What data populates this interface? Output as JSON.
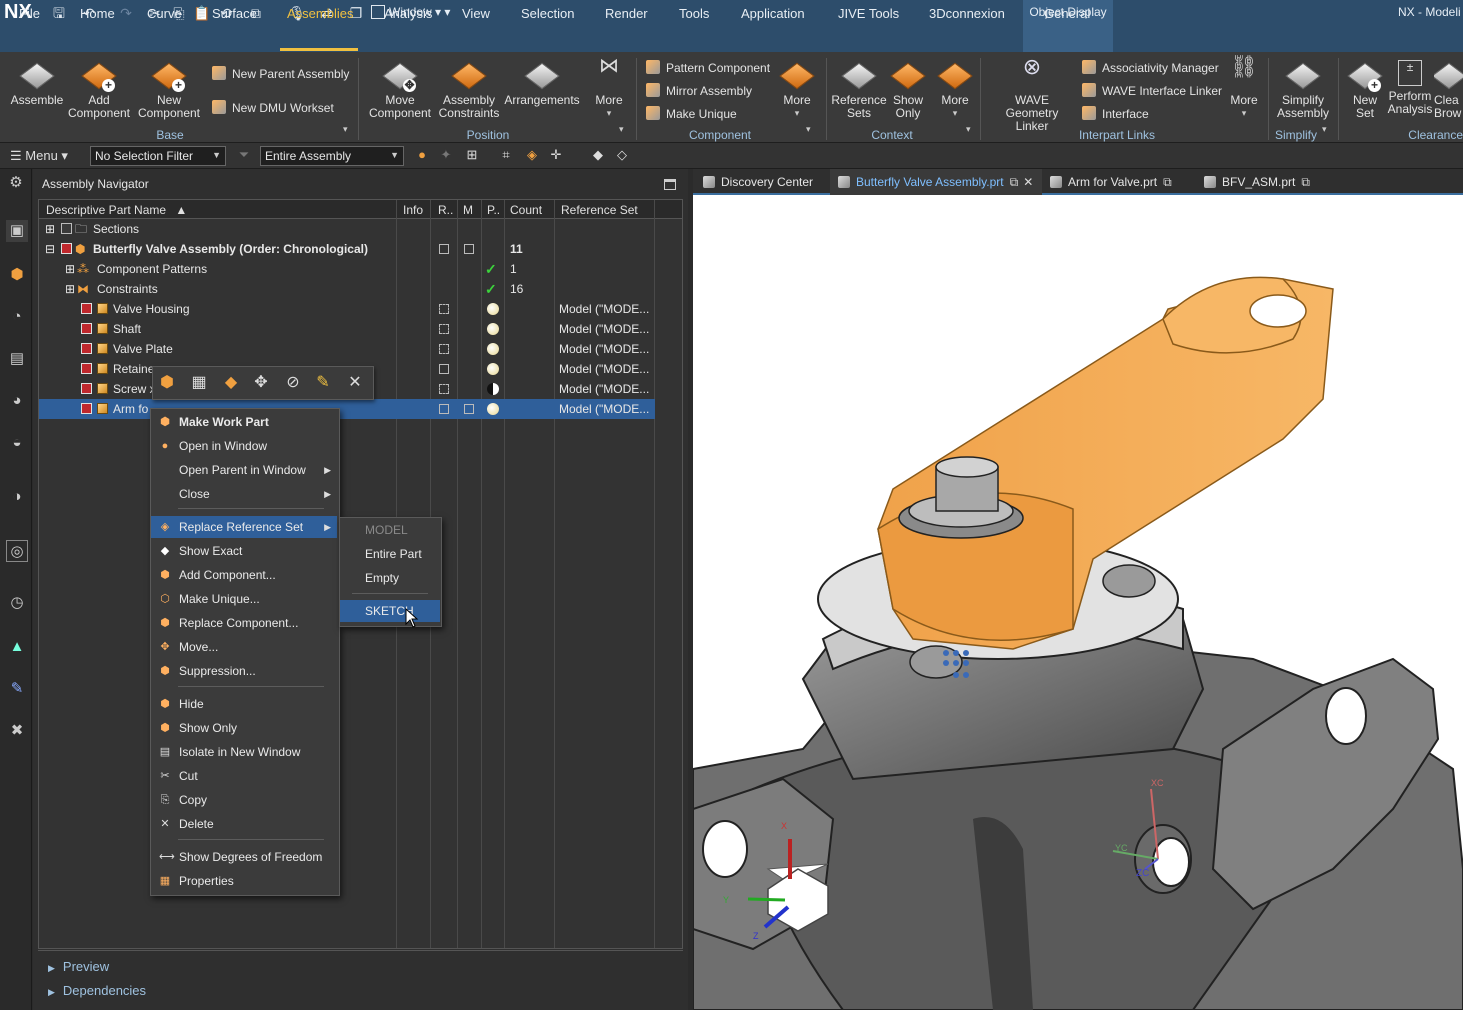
{
  "app": {
    "logo": "NX",
    "title": "NX - Modeli",
    "window_menu": "Window",
    "contextual_tab": "Object Display"
  },
  "tabs": [
    "File",
    "Home",
    "Curve",
    "Surface",
    "Assemblies",
    "Analysis",
    "View",
    "Selection",
    "Render",
    "Tools",
    "Application",
    "JIVE Tools",
    "3Dconnexion",
    "General"
  ],
  "active_tab": "Assemblies",
  "ribbon": {
    "assemble": "Assemble",
    "add_component": "Add Component",
    "new_component": "New Component",
    "new_parent_assembly": "New Parent Assembly",
    "new_dmu_workset": "New DMU Workset",
    "group_base": "Base",
    "move_component": "Move Component",
    "assembly_constraints": "Assembly Constraints",
    "arrangements": "Arrangements",
    "more_position": "More",
    "group_position": "Position",
    "pattern_component": "Pattern Component",
    "mirror_assembly": "Mirror Assembly",
    "make_unique": "Make Unique",
    "more_component": "More",
    "group_component": "Component",
    "reference_sets": "Reference Sets",
    "show_only": "Show Only",
    "more_context": "More",
    "group_context": "Context",
    "wave_geometry_linker": "WAVE Geometry Linker",
    "associativity_manager": "Associativity Manager",
    "wave_interface_linker": "WAVE Interface Linker",
    "interface": "Interface",
    "more_interpart": "More",
    "group_interpart": "Interpart Links",
    "simplify_assembly": "Simplify Assembly",
    "group_simplify": "Simplify",
    "new_set": "New Set",
    "perform_analysis": "Perform Analysis",
    "clean_brow": "Clea Brow",
    "group_clearance": "Clearance"
  },
  "toolbar": {
    "menu": "Menu",
    "selection_filter": "No Selection Filter",
    "scope": "Entire Assembly"
  },
  "navigator": {
    "title": "Assembly Navigator",
    "columns": [
      "Descriptive Part Name",
      "Info",
      "R..",
      "M",
      "P..",
      "Count",
      "Reference Set"
    ],
    "rows": [
      {
        "name": "Sections",
        "count": "",
        "refset": ""
      },
      {
        "name": "Butterfly Valve Assembly (Order: Chronological)",
        "count": "11",
        "refset": ""
      },
      {
        "name": "Component Patterns",
        "count": "1",
        "refset": ""
      },
      {
        "name": "Constraints",
        "count": "16",
        "refset": ""
      },
      {
        "name": "Valve Housing",
        "count": "",
        "refset": "Model (\"MODE..."
      },
      {
        "name": "Shaft",
        "count": "",
        "refset": "Model (\"MODE..."
      },
      {
        "name": "Valve Plate",
        "count": "",
        "refset": "Model (\"MODE..."
      },
      {
        "name": "Retaine",
        "count": "",
        "refset": "Model (\"MODE..."
      },
      {
        "name": "Screw x",
        "count": "",
        "refset": "Model (\"MODE..."
      },
      {
        "name": "Arm fo",
        "count": "",
        "refset": "Model (\"MODE..."
      }
    ],
    "preview": "Preview",
    "dependencies": "Dependencies"
  },
  "context_menu": [
    "Make Work Part",
    "Open in Window",
    "Open Parent in Window",
    "Close",
    "Replace Reference Set",
    "Show Exact",
    "Add Component...",
    "Make Unique...",
    "Replace Component...",
    "Move...",
    "Suppression...",
    "Hide",
    "Show Only",
    "Isolate in New Window",
    "Cut",
    "Copy",
    "Delete",
    "Show Degrees of Freedom",
    "Properties"
  ],
  "submenu": [
    "MODEL",
    "Entire Part",
    "Empty",
    "SKETCH"
  ],
  "graphics_tabs": [
    "Discovery Center",
    "Butterfly Valve Assembly.prt",
    "Arm for Valve.prt",
    "BFV_ASM.prt"
  ],
  "triad": {
    "x": "X",
    "y": "Y",
    "z": "Z",
    "xc": "XC",
    "yc": "YC",
    "zc": "ZC"
  }
}
